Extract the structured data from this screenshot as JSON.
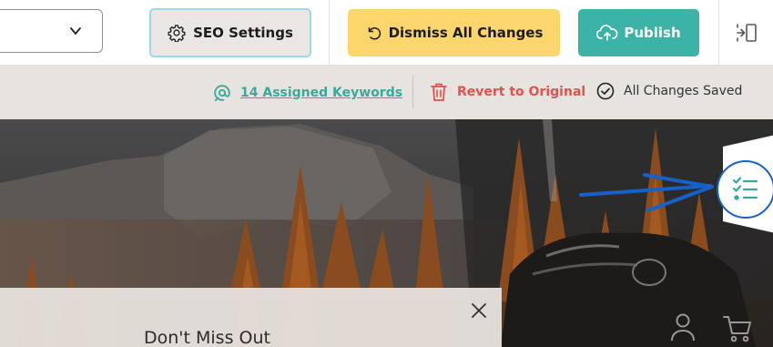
{
  "toolbar": {
    "seo_settings_label": "SEO Settings",
    "dismiss_label": "Dismiss All Changes",
    "publish_label": "Publish",
    "icons": {
      "dropdown": "chevron-down-icon",
      "seo": "gear-icon",
      "dismiss": "undo-icon",
      "publish": "cloud-upload-icon",
      "panel": "sidebar-toggle-icon"
    }
  },
  "status": {
    "keywords_label": "14 Assigned Keywords",
    "revert_label": "Revert to Original",
    "saved_label": "All Changes Saved",
    "icons": {
      "keywords": "at-sign-icon",
      "revert": "trash-icon",
      "saved": "check-circle-icon"
    }
  },
  "popup": {
    "title": "Don't Miss Out"
  },
  "colors": {
    "accent_teal": "#3bb3a6",
    "dismiss_yellow": "#fcd56d",
    "revert_red": "#e2534f",
    "annotation_blue": "#1560c9"
  }
}
